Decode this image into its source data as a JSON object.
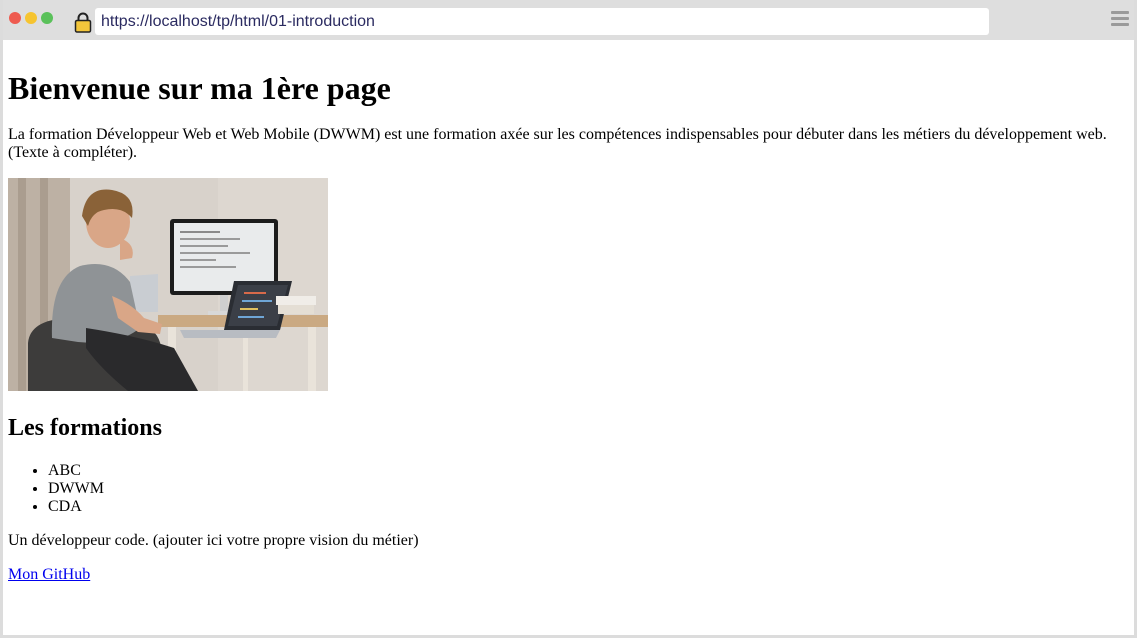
{
  "browser": {
    "url": "https://localhost/tp/html/01-introduction",
    "colors": {
      "close": "#ee5b50",
      "minimize": "#f6c430",
      "maximize": "#5ac15a",
      "lock": "#f3c63b"
    },
    "icons": [
      "lock-icon",
      "menu-icon"
    ]
  },
  "page": {
    "heading": "Bienvenue sur ma 1ère page",
    "intro": "La formation Développeur Web et Web Mobile (DWWM) est une formation axée sur les compétences indispensables pour débuter dans les métiers du développement web. (Texte à compléter).",
    "image_subject": "developer-working-at-desk",
    "subheading": "Les formations",
    "formations": [
      "ABC",
      "DWWM",
      "CDA"
    ],
    "vision": "Un développeur code. (ajouter ici votre propre vision du métier)",
    "github_link": "Mon GitHub"
  }
}
